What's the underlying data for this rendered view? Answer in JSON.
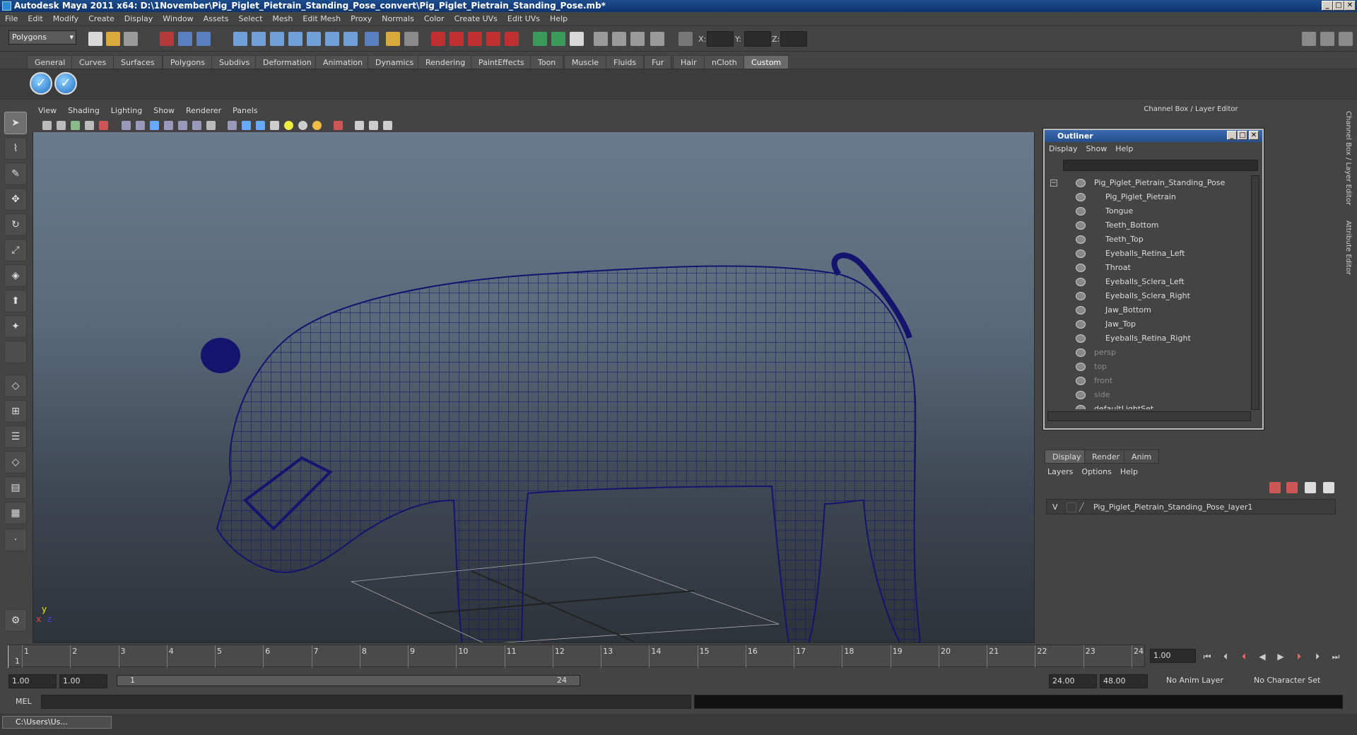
{
  "window": {
    "title": "Autodesk Maya 2011 x64: D:\\1November\\Pig_Piglet_Pietrain_Standing_Pose_convert\\Pig_Piglet_Pietrain_Standing_Pose.mb*",
    "min": "_",
    "max": "□",
    "close": "✕"
  },
  "menubar": [
    "File",
    "Edit",
    "Modify",
    "Create",
    "Display",
    "Window",
    "Assets",
    "Select",
    "Mesh",
    "Edit Mesh",
    "Proxy",
    "Normals",
    "Color",
    "Create UVs",
    "Edit UVs",
    "Help"
  ],
  "status": {
    "mode": "Polygons",
    "x_label": "X:",
    "y_label": "Y:",
    "z_label": "Z:"
  },
  "shelf_tabs": [
    "General",
    "Curves",
    "Surfaces",
    "Polygons",
    "Subdivs",
    "Deformation",
    "Animation",
    "Dynamics",
    "Rendering",
    "PaintEffects",
    "Toon",
    "Muscle",
    "Fluids",
    "Fur",
    "Hair",
    "nCloth",
    "Custom"
  ],
  "shelf_active": "Custom",
  "viewport": {
    "menus": [
      "View",
      "Shading",
      "Lighting",
      "Show",
      "Renderer",
      "Panels"
    ],
    "axis_y": "y",
    "axis_x": "x",
    "axis_z": "z"
  },
  "channel_box": {
    "title": "Channel Box / Layer Editor"
  },
  "side_tabs": {
    "channel": "Channel Box / Layer Editor",
    "attribute": "Attribute Editor"
  },
  "outliner": {
    "title": "Outliner",
    "menus": [
      "Display",
      "Show",
      "Help"
    ],
    "items": [
      {
        "label": "Pig_Piglet_Pietrain_Standing_Pose",
        "level": 0,
        "dim": false
      },
      {
        "label": "Pig_Piglet_Pietrain",
        "level": 1,
        "dim": false
      },
      {
        "label": "Tongue",
        "level": 1,
        "dim": false
      },
      {
        "label": "Teeth_Bottom",
        "level": 1,
        "dim": false
      },
      {
        "label": "Teeth_Top",
        "level": 1,
        "dim": false
      },
      {
        "label": "Eyeballs_Retina_Left",
        "level": 1,
        "dim": false
      },
      {
        "label": "Throat",
        "level": 1,
        "dim": false
      },
      {
        "label": "Eyeballs_Sclera_Left",
        "level": 1,
        "dim": false
      },
      {
        "label": "Eyeballs_Sclera_Right",
        "level": 1,
        "dim": false
      },
      {
        "label": "Jaw_Bottom",
        "level": 1,
        "dim": false
      },
      {
        "label": "Jaw_Top",
        "level": 1,
        "dim": false
      },
      {
        "label": "Eyeballs_Retina_Right",
        "level": 1,
        "dim": false
      },
      {
        "label": "persp",
        "level": 0,
        "dim": true
      },
      {
        "label": "top",
        "level": 0,
        "dim": true
      },
      {
        "label": "front",
        "level": 0,
        "dim": true
      },
      {
        "label": "side",
        "level": 0,
        "dim": true
      },
      {
        "label": "defaultLightSet",
        "level": 0,
        "dim": false
      }
    ]
  },
  "layer_editor": {
    "tabs": [
      "Display",
      "Render",
      "Anim"
    ],
    "active_tab": "Display",
    "menus": [
      "Layers",
      "Options",
      "Help"
    ],
    "layer_visible": "V",
    "layer_name": "Pig_Piglet_Pietrain_Standing_Pose_layer1"
  },
  "timeline": {
    "ticks": [
      1,
      2,
      3,
      4,
      5,
      6,
      7,
      8,
      9,
      10,
      11,
      12,
      13,
      14,
      15,
      16,
      17,
      18,
      19,
      20,
      21,
      22,
      23,
      24
    ],
    "current": "1",
    "current_frame_field": "1.00"
  },
  "range": {
    "start": "1.00",
    "start2": "1.00",
    "slider_start": "1",
    "slider_end": "24",
    "end": "24.00",
    "end2": "48.00",
    "anim_layer": "No Anim Layer",
    "character_set": "No Character Set"
  },
  "mel": {
    "label": "MEL"
  },
  "taskbar": {
    "item": "C:\\Users\\Us..."
  }
}
